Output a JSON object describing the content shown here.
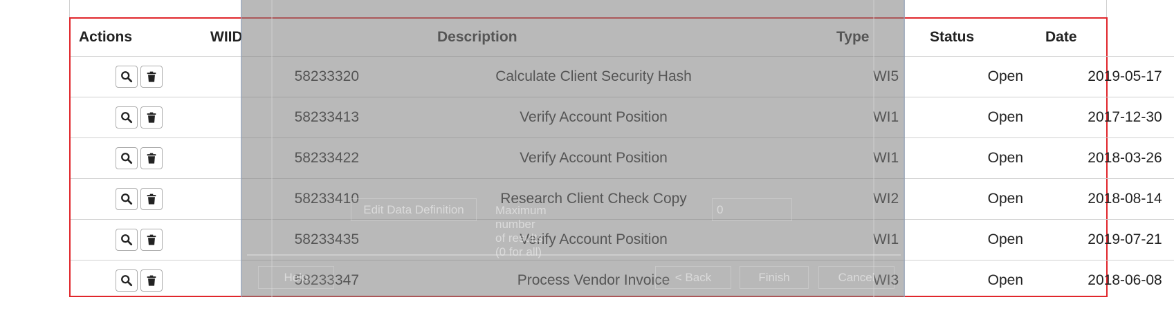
{
  "table": {
    "headers": {
      "actions": "Actions",
      "wiid": "WIID",
      "description": "Description",
      "type": "Type",
      "status": "Status",
      "date": "Date"
    },
    "rows": [
      {
        "wiid": "58233320",
        "description": "Calculate Client Security Hash",
        "type": "WI5",
        "status": "Open",
        "date": "2019-05-17"
      },
      {
        "wiid": "58233413",
        "description": "Verify Account Position",
        "type": "WI1",
        "status": "Open",
        "date": "2017-12-30"
      },
      {
        "wiid": "58233422",
        "description": "Verify Account Position",
        "type": "WI1",
        "status": "Open",
        "date": "2018-03-26"
      },
      {
        "wiid": "58233410",
        "description": "Research Client Check Copy",
        "type": "WI2",
        "status": "Open",
        "date": "2018-08-14"
      },
      {
        "wiid": "58233435",
        "description": "Verify Account Position",
        "type": "WI1",
        "status": "Open",
        "date": "2019-07-21"
      },
      {
        "wiid": "58233347",
        "description": "Process Vendor Invoice",
        "type": "WI3",
        "status": "Open",
        "date": "2018-06-08"
      }
    ],
    "row_action_icons": [
      "search-icon",
      "trash-icon"
    ]
  },
  "dialog": {
    "edit_button": "Edit Data Definition",
    "max_results_label": "Maximum number of results (0 for all)",
    "max_results_value": "0",
    "help_button": "Help",
    "back_button": "< Back",
    "finish_button": "Finish",
    "cancel_button": "Cancel"
  },
  "colors": {
    "grid_border": "#e0262b",
    "overlay": "#808080"
  }
}
